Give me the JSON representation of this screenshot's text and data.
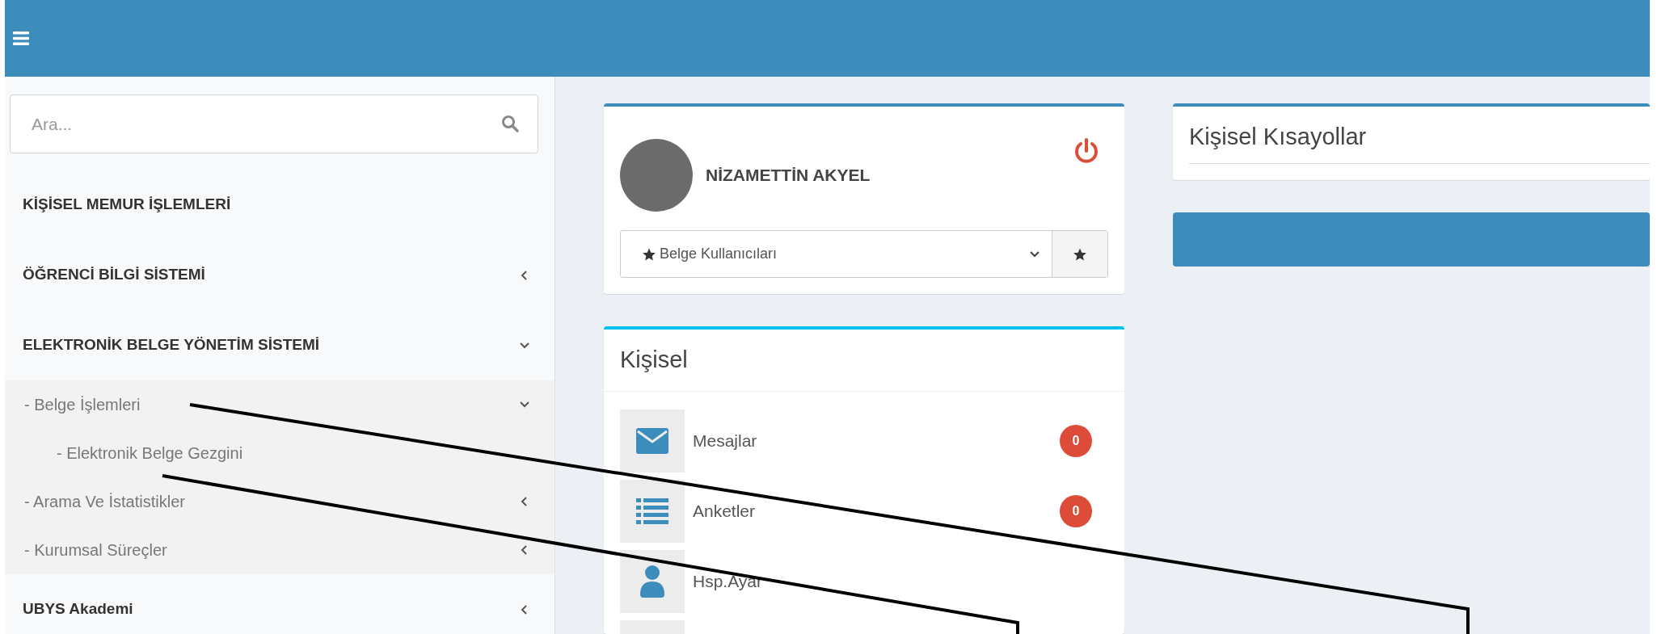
{
  "sidebar": {
    "search": {
      "placeholder": "Ara..."
    },
    "items": [
      {
        "label": "KİŞİSEL MEMUR İŞLEMLERİ"
      },
      {
        "label": "ÖĞRENCİ BİLGİ SİSTEMİ",
        "expanded": false
      },
      {
        "label": "ELEKTRONİK BELGE YÖNETİM SİSTEMİ",
        "expanded": true,
        "children": [
          {
            "label": "- Belge İşlemleri",
            "expanded": true,
            "children": [
              {
                "label": "- Elektronik Belge Gezgini"
              }
            ]
          },
          {
            "label": "- Arama Ve İstatistikler",
            "expanded": false
          },
          {
            "label": "- Kurumsal Süreçler",
            "expanded": false
          }
        ]
      },
      {
        "label": "UBYS Akademi",
        "expanded": false
      }
    ]
  },
  "profile": {
    "name": "NİZAMETTİN AKYEL",
    "role_select": {
      "value": "Belge Kullanıcıları"
    }
  },
  "personal": {
    "title": "Kişisel",
    "items": [
      {
        "kind": "mail",
        "label": "Mesajlar",
        "count": "0"
      },
      {
        "kind": "list",
        "label": "Anketler",
        "count": "0"
      },
      {
        "kind": "user",
        "label": "Hsp.Ayar"
      },
      {
        "kind": "blank"
      }
    ]
  },
  "shortcuts": {
    "title": "Kişisel Kısayollar"
  }
}
